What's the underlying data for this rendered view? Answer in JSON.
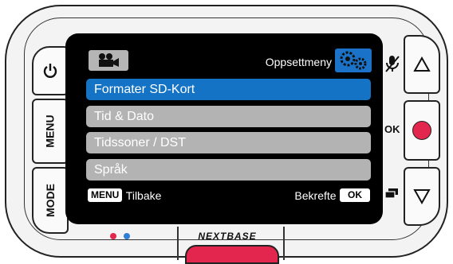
{
  "device": {
    "brand": "NEXTBASE",
    "left_buttons": {
      "menu_label": "MENU",
      "mode_label": "MODE"
    },
    "right_labels": {
      "ok_label": "OK"
    }
  },
  "screen": {
    "header": {
      "title": "Oppsettmeny",
      "camera_icon": "video-camera-icon",
      "settings_icon": "gears-icon"
    },
    "menu_items": [
      {
        "label": "Formater SD-Kort",
        "selected": true
      },
      {
        "label": "Tid & Dato",
        "selected": false
      },
      {
        "label": "Tidssoner / DST",
        "selected": false
      },
      {
        "label": "Språk",
        "selected": false
      }
    ],
    "footer": {
      "menu_key": "MENU",
      "back_label": "Tilbake",
      "confirm_label": "Bekrefte",
      "ok_key": "OK"
    }
  },
  "colors": {
    "selected": "#1473c5",
    "item": "#b3b3b3",
    "record": "#e3264d",
    "led_red": "#e3264d",
    "led_blue": "#2f7fd8"
  }
}
